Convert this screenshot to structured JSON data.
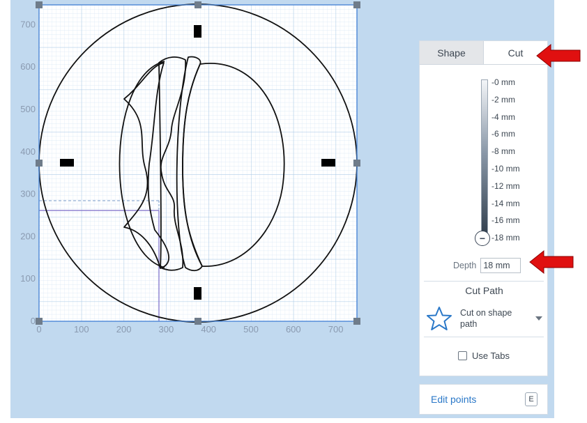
{
  "canvas": {
    "x_ticks": [
      "0",
      "100",
      "200",
      "300",
      "400",
      "500",
      "600",
      "700"
    ],
    "y_ticks": [
      "0",
      "100",
      "200",
      "300",
      "400",
      "500",
      "600",
      "700"
    ],
    "colors": {
      "background": "#c1d9ef",
      "grid": "#bcd6ee",
      "selection": "#4a86d6",
      "guide": "#7a6bc8",
      "shape": "#111111"
    }
  },
  "panel": {
    "tabs": [
      {
        "label": "Shape",
        "active": false
      },
      {
        "label": "Cut",
        "active": true
      }
    ],
    "depth_scale": [
      "-0 mm",
      "-2 mm",
      "-4 mm",
      "-6 mm",
      "-8 mm",
      "-10 mm",
      "-12 mm",
      "-14 mm",
      "-16 mm",
      "-18 mm"
    ],
    "slider_knob_glyph": "−",
    "slider_value": "-18 mm",
    "depth_label": "Depth",
    "depth_value": "18 mm",
    "cut_path_title": "Cut Path",
    "cut_path_icon": "star-icon",
    "cut_path_selected": "Cut on shape path",
    "use_tabs_label": "Use Tabs",
    "use_tabs_checked": false
  },
  "edit_points": {
    "label": "Edit points",
    "shortcut": "E"
  },
  "annotations": {
    "arrow_color": "#e01010",
    "arrows": [
      "cut-tab-arrow",
      "depth-input-arrow"
    ]
  }
}
